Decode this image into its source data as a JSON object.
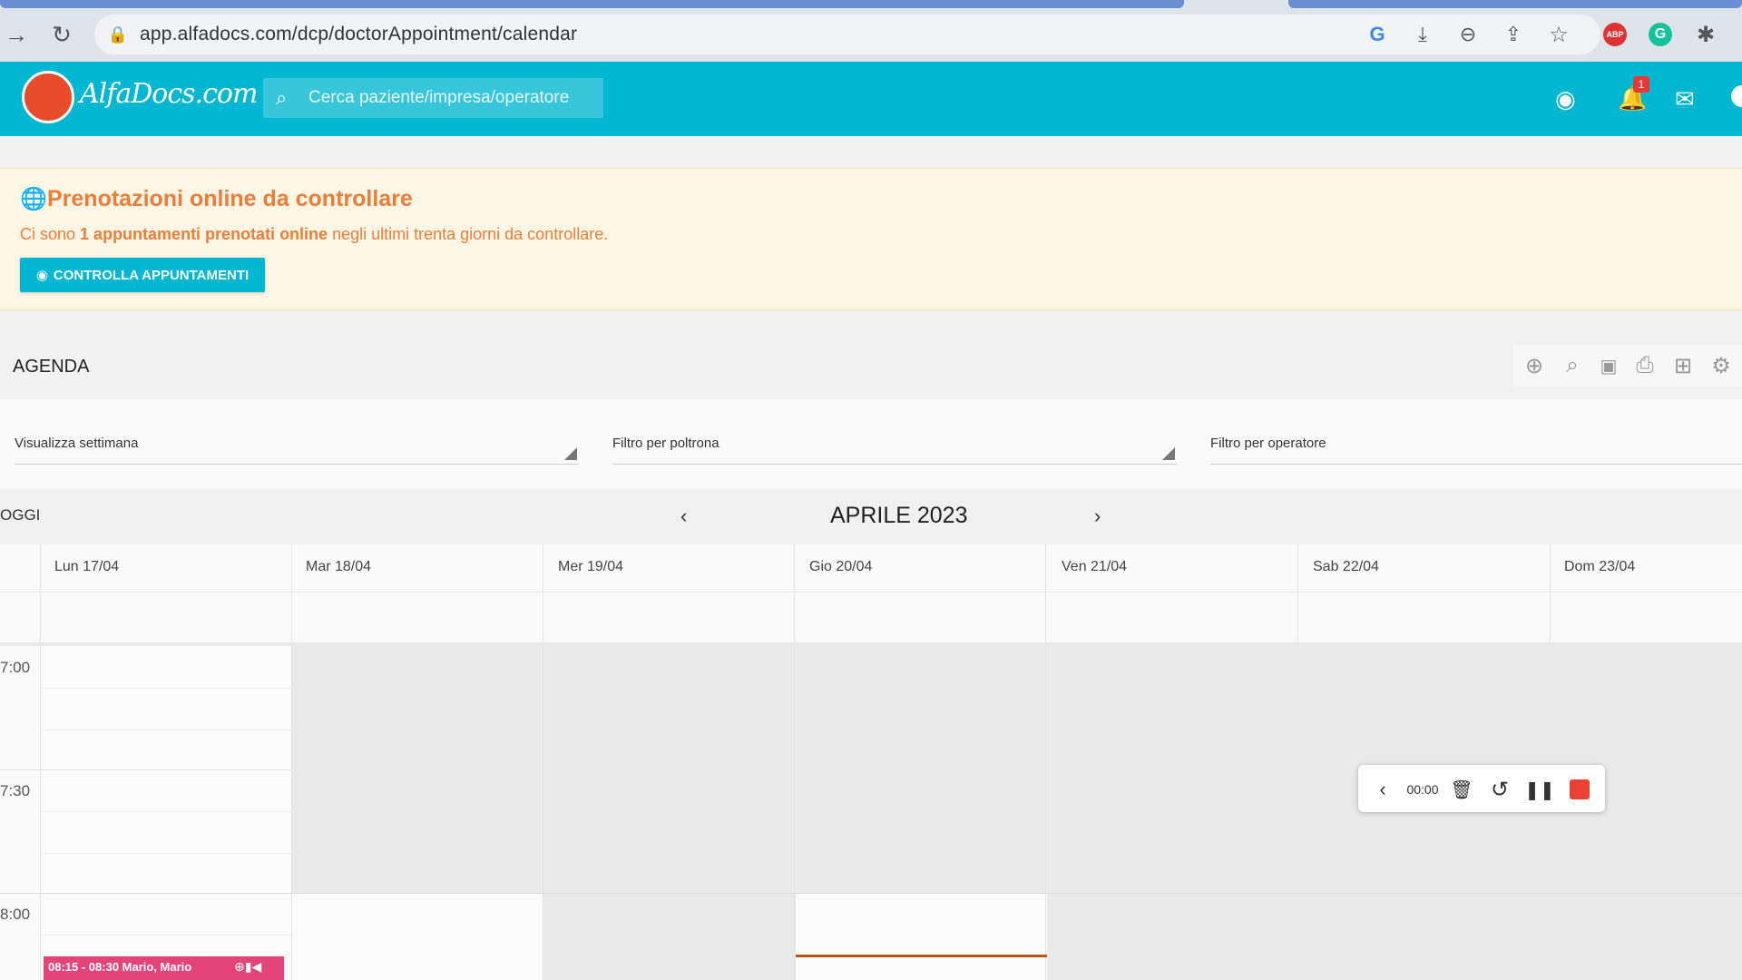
{
  "browser": {
    "url": "app.alfadocs.com/dcp/doctorAppointment/calendar",
    "icons": [
      "back-icon",
      "reload-icon",
      "lock-icon",
      "google-icon",
      "download-icon",
      "zoom-out-icon",
      "share-icon",
      "star-icon",
      "adblock-icon",
      "grammarly-icon",
      "extensions-icon"
    ],
    "adblock_label": "ABP"
  },
  "header": {
    "logo_text": "AlfaDocs.com",
    "search_placeholder": "Cerca paziente/impresa/operatore",
    "notification_count": "1"
  },
  "alert": {
    "title": "Prenotazioni online da controllare",
    "text_prefix": "Ci sono ",
    "text_bold": "1 appuntamenti prenotati online",
    "text_suffix": " negli ultimi trenta giorni da controllare.",
    "button_label": "CONTROLLA APPUNTAMENTI",
    "color": "#ec7c3a"
  },
  "agenda": {
    "title": "AGENDA",
    "tools": [
      "add-icon",
      "search-icon",
      "calendar-icon",
      "print-icon",
      "briefcase-clock-icon",
      "settings-icon"
    ]
  },
  "filters": {
    "view": "Visualizza settimana",
    "chair": "Filtro per poltrona",
    "operator": "Filtro per operatore"
  },
  "calendar": {
    "today_label": "OGGI",
    "month_label": "APRILE 2023",
    "prev": "‹",
    "next": "›",
    "days": [
      "Lun 17/04",
      "Mar 18/04",
      "Mer 19/04",
      "Gio 20/04",
      "Ven 21/04",
      "Sab 22/04",
      "Dom 23/04"
    ],
    "times": [
      "7:00",
      "7:30",
      "8:00"
    ],
    "event": {
      "label": "08:15 - 08:30 Mario, Mario",
      "color": "#e4447a"
    }
  },
  "recorder": {
    "time": "00:00"
  },
  "colors": {
    "brand": "#00b6d0",
    "alert_bg": "#fdf6e4"
  }
}
